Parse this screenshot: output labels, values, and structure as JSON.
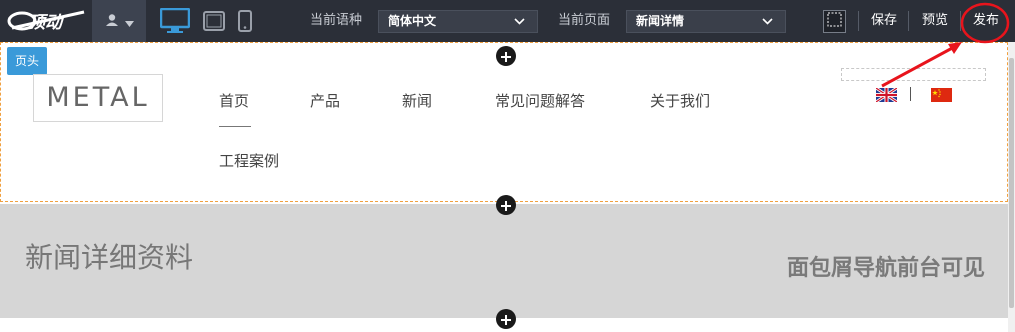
{
  "toolbar": {
    "logo_text": "E顶动",
    "language_label": "当前语种",
    "language_value": "简体中文",
    "page_label": "当前页面",
    "page_value": "新闻详情",
    "save": "保存",
    "preview": "预览",
    "publish": "发布"
  },
  "header": {
    "section_tag": "页头",
    "brand": "METAL",
    "nav": [
      "首页",
      "产品",
      "新闻",
      "常见问题解答",
      "关于我们",
      "工程案例"
    ]
  },
  "banner": {
    "title": "新闻详细资料",
    "breadcrumb_note": "面包屑导航前台可见"
  },
  "icons": {
    "user": "user-icon",
    "desktop": "desktop-icon",
    "tablet": "tablet-icon",
    "mobile": "mobile-icon",
    "grid": "grid-toggle-icon",
    "add": "plus-circle-icon",
    "flag_en": "uk-flag-icon",
    "flag_cn": "china-flag-icon"
  },
  "colors": {
    "toolbar_bg": "#2b2f38",
    "accent_blue": "#3a9ad9",
    "dashed_border": "#f0a040",
    "banner_bg": "#d6d6d6",
    "annotation_red": "#e8141c"
  }
}
